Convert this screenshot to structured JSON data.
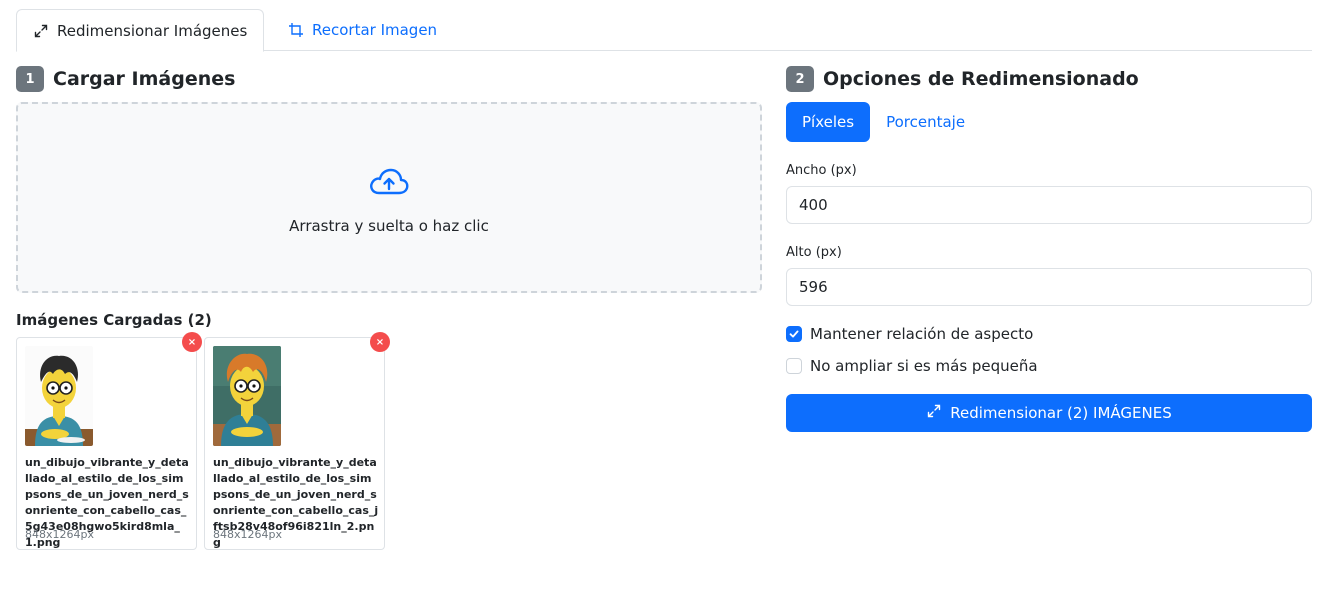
{
  "tabs": [
    {
      "label": "Redimensionar Imágenes",
      "icon": "expand-arrows-icon",
      "active": true
    },
    {
      "label": "Recortar Imagen",
      "icon": "crop-icon",
      "active": false
    }
  ],
  "upload": {
    "step": "1",
    "title": "Cargar Imágenes",
    "drop_text": "Arrastra y suelta o haz clic",
    "icon": "cloud-upload-icon",
    "loaded_title": "Imágenes Cargadas (2)",
    "images": [
      {
        "filename": "un_dibujo_vibrante_y_detallado_al_estilo_de_los_simpsons_de_un_joven_nerd_sonriente_con_cabello_cas_5g43e08hgwo5kird8mla_1.png",
        "dims": "848x1264px",
        "remove_label": "×"
      },
      {
        "filename": "un_dibujo_vibrante_y_detallado_al_estilo_de_los_simpsons_de_un_joven_nerd_sonriente_con_cabello_cas_jftsb28v48of96i821ln_2.png",
        "dims": "848x1264px",
        "remove_label": "×"
      }
    ]
  },
  "options": {
    "step": "2",
    "title": "Opciones de Redimensionado",
    "mode_pixels": "Píxeles",
    "mode_percent": "Porcentaje",
    "width_label": "Ancho (px)",
    "width_value": "400",
    "height_label": "Alto (px)",
    "height_value": "596",
    "keep_aspect": "Mantener relación de aspecto",
    "keep_aspect_checked": true,
    "no_upscale": "No ampliar si es más pequeña",
    "no_upscale_checked": false,
    "submit_label": "Redimensionar (2) IMÁGENES"
  },
  "colors": {
    "primary": "#0d6efd",
    "badge": "#6c757d",
    "remove": "#f44c4c"
  }
}
